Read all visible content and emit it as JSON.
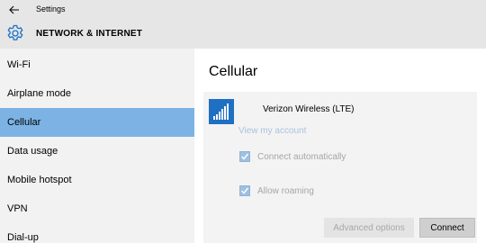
{
  "window": {
    "title": "Settings"
  },
  "header": {
    "title": "NETWORK & INTERNET",
    "icon": "gear-icon"
  },
  "sidebar": {
    "items": [
      {
        "label": "Wi-Fi"
      },
      {
        "label": "Airplane mode"
      },
      {
        "label": "Cellular",
        "selected": true
      },
      {
        "label": "Data usage"
      },
      {
        "label": "Mobile hotspot"
      },
      {
        "label": "VPN"
      },
      {
        "label": "Dial-up"
      }
    ]
  },
  "main": {
    "title": "Cellular",
    "network": {
      "name": "Verizon Wireless (LTE)",
      "icon": "signal-bars-icon",
      "view_account": "View my account",
      "connect_auto": {
        "label": "Connect automatically",
        "checked": true
      },
      "allow_roaming": {
        "label": "Allow roaming",
        "checked": true
      },
      "advanced_label": "Advanced options",
      "connect_label": "Connect"
    }
  },
  "colors": {
    "accent": "#7cb3e4",
    "tile": "#1f6fc3",
    "titlebar": "#e6e6e6",
    "sidebar": "#f2f2f2"
  }
}
